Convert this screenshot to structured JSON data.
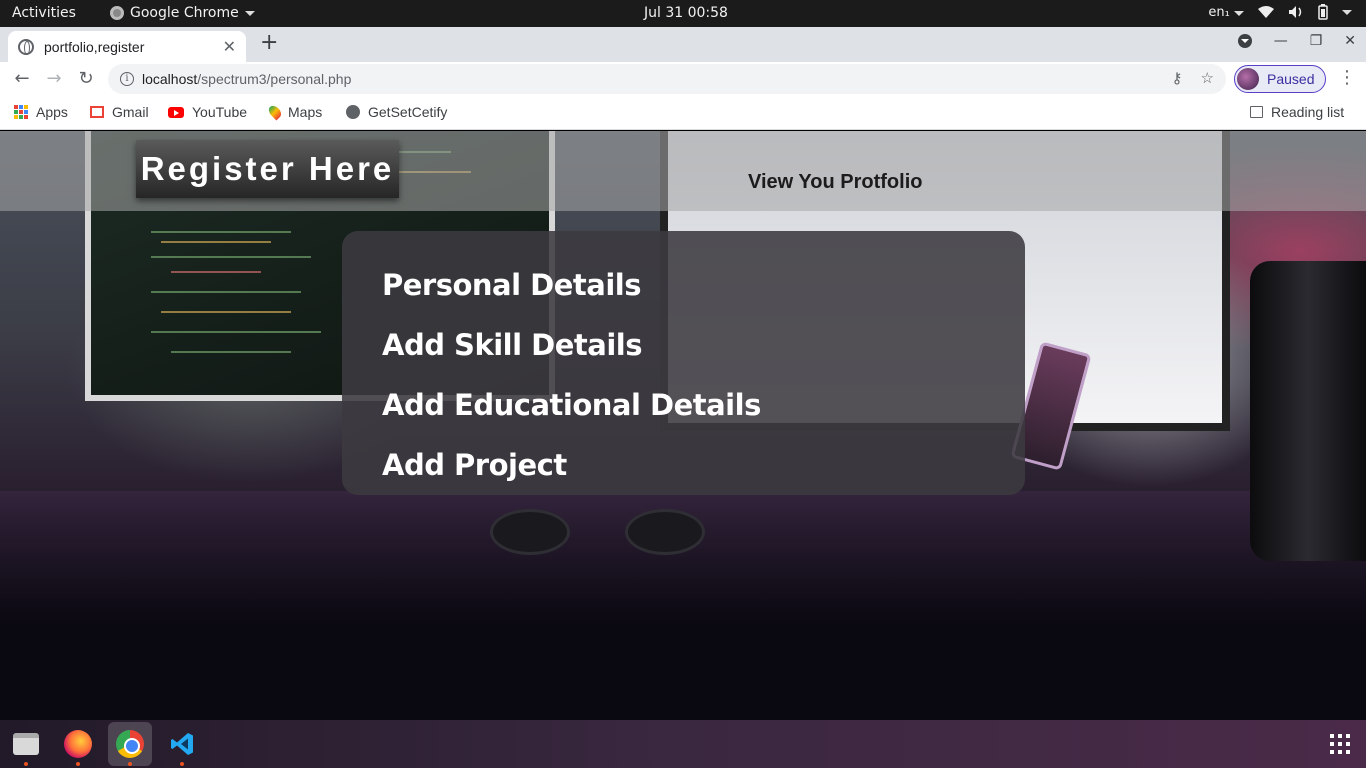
{
  "system_bar": {
    "activities": "Activities",
    "app_name": "Google Chrome",
    "clock": "Jul 31  00:58",
    "input_lang": "en₁"
  },
  "browser": {
    "tab_title": "portfolio,register",
    "new_tab": "+",
    "url_host": "localhost",
    "url_path": "/spectrum3/personal.php",
    "profile_status": "Paused",
    "bookmarks": [
      "Apps",
      "Gmail",
      "YouTube",
      "Maps",
      "GetSetCetify"
    ],
    "reading_list": "Reading list"
  },
  "page": {
    "brand": "Register Here",
    "nav_link": "View You Protfolio",
    "menu": [
      "Personal Details",
      "Add Skill Details",
      "Add Educational Details",
      "Add Project"
    ]
  },
  "dock": {
    "apps": [
      "files-icon",
      "firefox-icon",
      "chrome-icon",
      "vscode-icon"
    ],
    "accent": "#e95420"
  }
}
